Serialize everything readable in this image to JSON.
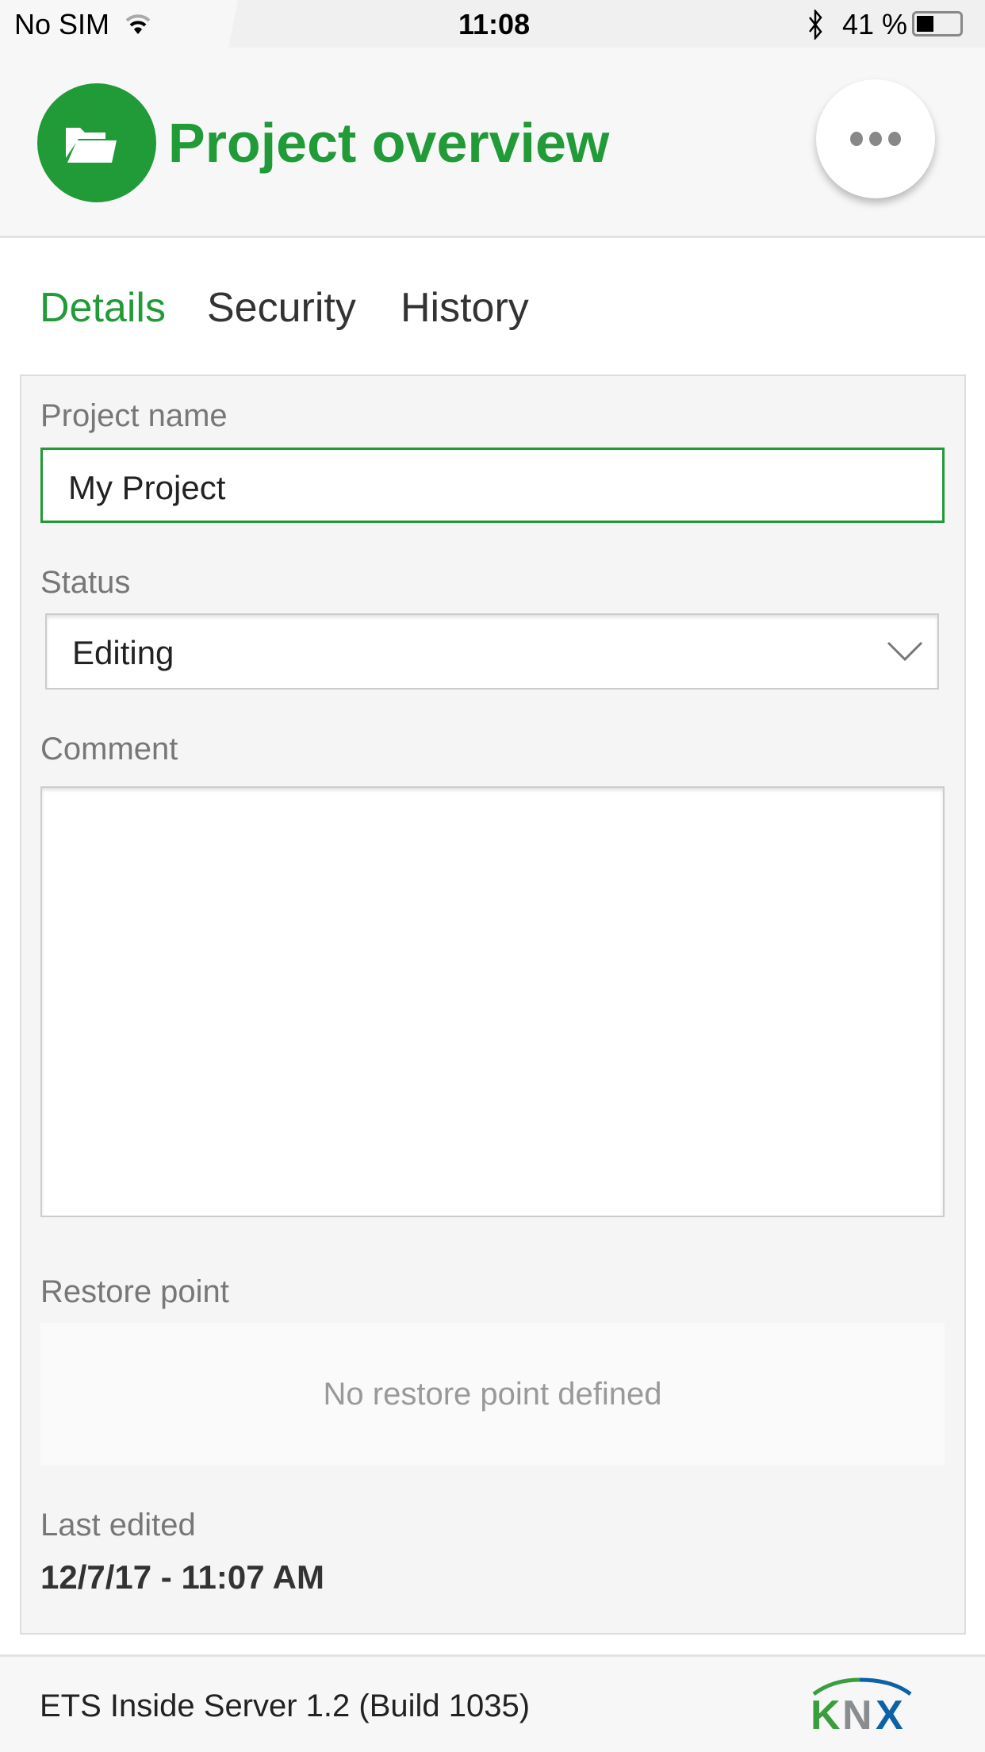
{
  "status_bar": {
    "carrier": "No SIM",
    "time": "11:08",
    "battery": "41 %"
  },
  "header": {
    "title": "Project overview",
    "icon": "folder-open-icon",
    "more_icon": "more-horizontal-icon"
  },
  "tabs": [
    {
      "label": "Details",
      "active": true
    },
    {
      "label": "Security",
      "active": false
    },
    {
      "label": "History",
      "active": false
    }
  ],
  "form": {
    "project_name_label": "Project name",
    "project_name_value": "My Project",
    "status_label": "Status",
    "status_value": "Editing",
    "comment_label": "Comment",
    "comment_value": "",
    "restore_label": "Restore point",
    "restore_empty": "No restore point defined",
    "last_edited_label": "Last edited",
    "last_edited_value": "12/7/17 - 11:07 AM"
  },
  "footer": {
    "version": "ETS Inside Server 1.2 (Build 1035)",
    "logo": "KNX"
  },
  "colors": {
    "accent": "#219a38",
    "knx_blue": "#0b62a6",
    "knx_gray": "#8a8d8f"
  }
}
